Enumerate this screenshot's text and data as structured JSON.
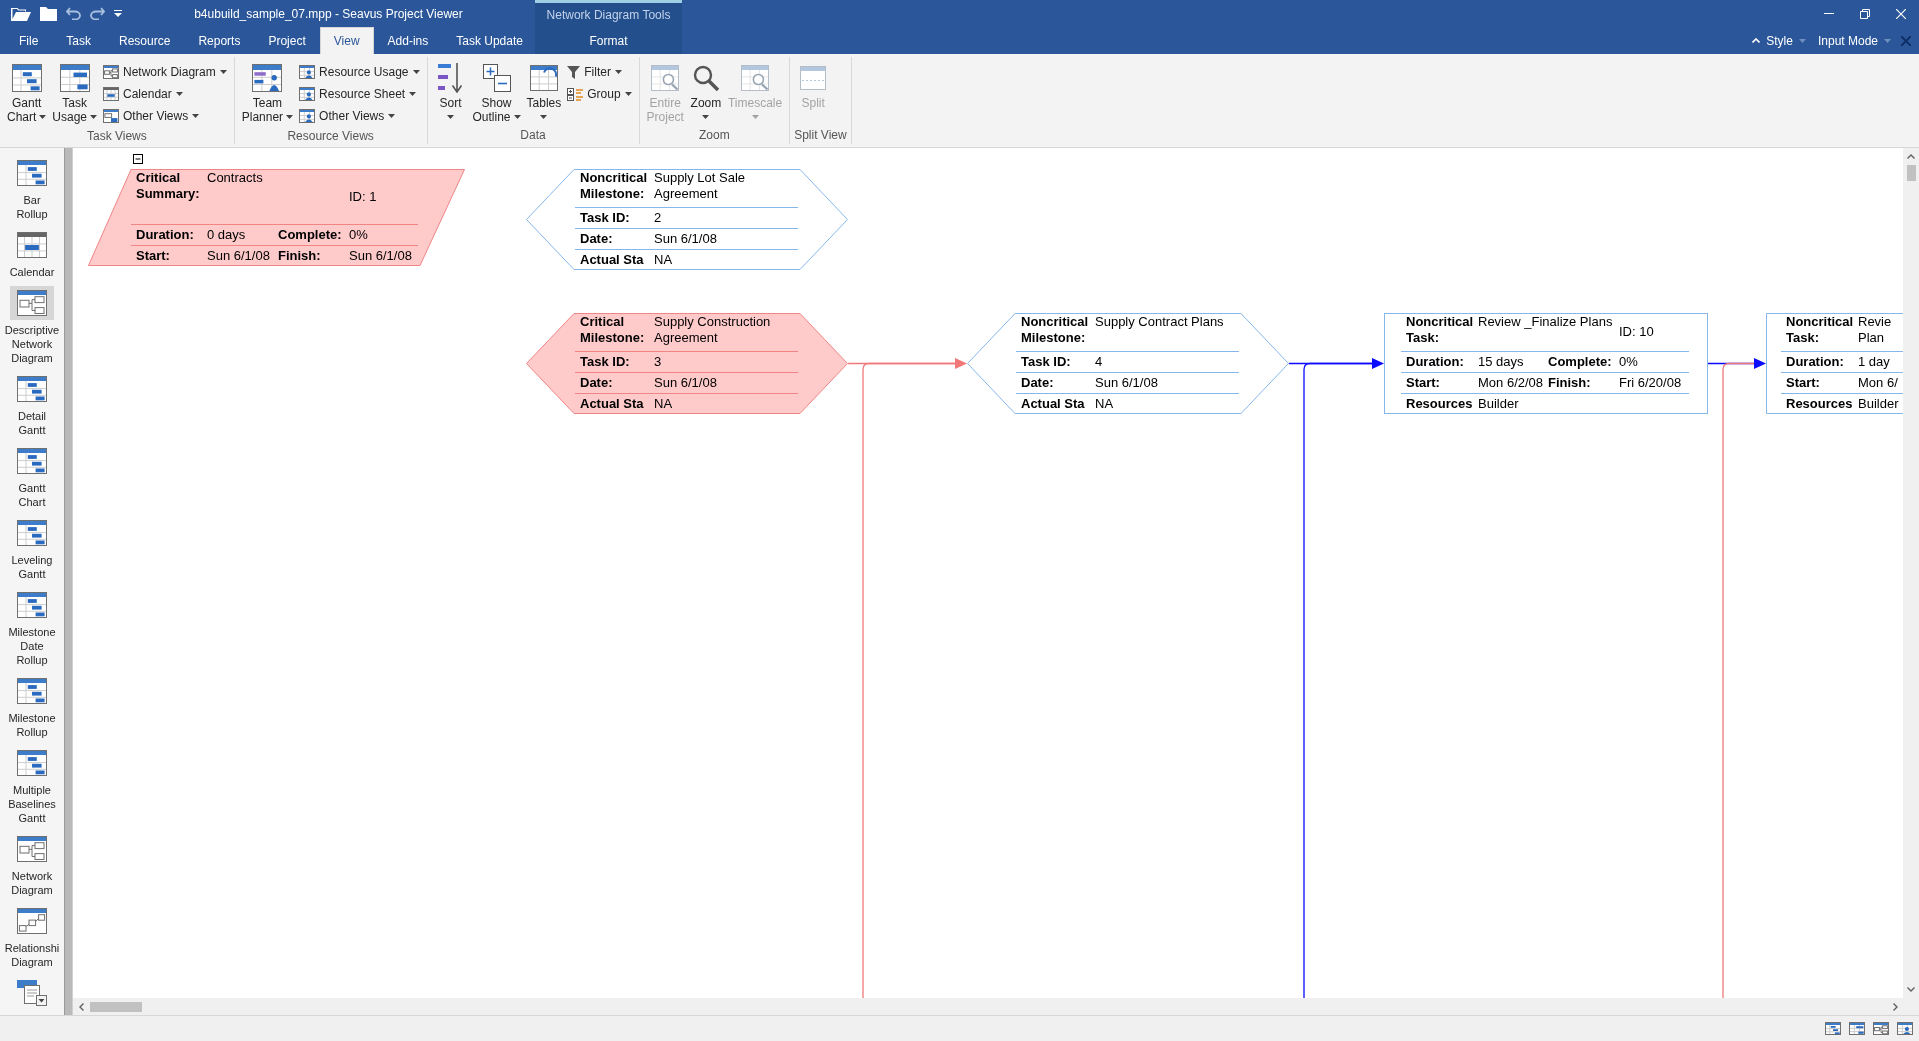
{
  "window": {
    "title": "b4ubuild_sample_07.mpp - Seavus Project Viewer",
    "contextual_group": "Network Diagram Tools"
  },
  "tabs": [
    {
      "label": "File",
      "selected": false
    },
    {
      "label": "Task",
      "selected": false
    },
    {
      "label": "Resource",
      "selected": false
    },
    {
      "label": "Reports",
      "selected": false
    },
    {
      "label": "Project",
      "selected": false
    },
    {
      "label": "View",
      "selected": true
    },
    {
      "label": "Add-ins",
      "selected": false
    },
    {
      "label": "Task Update",
      "selected": false
    }
  ],
  "contextual_tabs": [
    {
      "label": "Format",
      "selected": false
    }
  ],
  "ribbon_options": [
    {
      "label": "Style",
      "dropdown": true
    },
    {
      "label": "Input Mode",
      "dropdown": true
    }
  ],
  "ribbon": {
    "groups": [
      {
        "label": "Task Views",
        "items": [
          {
            "kind": "large",
            "lines": [
              "Gantt",
              "Chart"
            ],
            "dropdown": true,
            "disabled": false
          },
          {
            "kind": "large",
            "lines": [
              "Task",
              "Usage"
            ],
            "dropdown": true,
            "disabled": false
          },
          {
            "kind": "small",
            "label": "Network Diagram",
            "dropdown": true,
            "disabled": false
          },
          {
            "kind": "small",
            "label": "Calendar",
            "dropdown": true,
            "disabled": false
          },
          {
            "kind": "small",
            "label": "Other Views",
            "dropdown": true,
            "disabled": false
          }
        ]
      },
      {
        "label": "Resource Views",
        "items": [
          {
            "kind": "large",
            "lines": [
              "Team",
              "Planner"
            ],
            "dropdown": true,
            "disabled": false
          },
          {
            "kind": "small",
            "label": "Resource Usage",
            "dropdown": true,
            "disabled": false
          },
          {
            "kind": "small",
            "label": "Resource Sheet",
            "dropdown": true,
            "disabled": false
          },
          {
            "kind": "small",
            "label": "Other Views",
            "dropdown": true,
            "disabled": false
          }
        ]
      },
      {
        "label": "Data",
        "items": [
          {
            "kind": "large",
            "lines": [
              "Sort"
            ],
            "dropdown": true,
            "disabled": false
          },
          {
            "kind": "large",
            "lines": [
              "Show",
              "Outline"
            ],
            "dropdown": true,
            "disabled": false
          },
          {
            "kind": "large",
            "lines": [
              "Tables"
            ],
            "dropdown": true,
            "disabled": false
          },
          {
            "kind": "small",
            "label": "Filter",
            "dropdown": true,
            "disabled": false
          },
          {
            "kind": "small",
            "label": "Group",
            "dropdown": true,
            "disabled": false
          }
        ]
      },
      {
        "label": "Zoom",
        "items": [
          {
            "kind": "large",
            "lines": [
              "Entire",
              "Project"
            ],
            "dropdown": false,
            "disabled": true
          },
          {
            "kind": "large",
            "lines": [
              "Zoom"
            ],
            "dropdown": true,
            "disabled": false
          },
          {
            "kind": "large",
            "lines": [
              "Timescale"
            ],
            "dropdown": true,
            "disabled": true
          }
        ]
      },
      {
        "label": "Split View",
        "items": [
          {
            "kind": "large",
            "lines": [
              "Split"
            ],
            "dropdown": false,
            "disabled": true
          }
        ]
      }
    ]
  },
  "sidebar": {
    "items": [
      {
        "label": "Bar Rollup",
        "kind": "gantt",
        "selected": false
      },
      {
        "label": "Calendar",
        "kind": "calendar",
        "selected": false
      },
      {
        "label": "Descriptive Network Diagram",
        "kind": "network",
        "selected": true
      },
      {
        "label": "Detail Gantt",
        "kind": "gantt",
        "selected": false
      },
      {
        "label": "Gantt Chart",
        "kind": "gantt",
        "selected": false
      },
      {
        "label": "Leveling Gantt",
        "kind": "gantt",
        "selected": false
      },
      {
        "label": "Milestone Date Rollup",
        "kind": "gantt",
        "selected": false
      },
      {
        "label": "Milestone Rollup",
        "kind": "gantt",
        "selected": false
      },
      {
        "label": "Multiple Baselines Gantt",
        "kind": "gantt",
        "selected": false
      },
      {
        "label": "Network Diagram",
        "kind": "network",
        "selected": false
      },
      {
        "label": "Relationshi Diagram",
        "kind": "relationship",
        "selected": false
      },
      {
        "kind": "form",
        "selected": false
      }
    ]
  },
  "diagram": {
    "nodes": [
      {
        "kind": "summary",
        "critical": true,
        "expanded": true,
        "type_label": "Critical Summary:",
        "name": "Contracts",
        "id_text": "ID: 1",
        "rows": [
          [
            {
              "label": "Duration:",
              "value": "0 days"
            },
            {
              "label": "Complete:",
              "value": "0%"
            }
          ],
          [
            {
              "label": "Start:",
              "value": "Sun 6/1/08"
            },
            {
              "label": "Finish:",
              "value": "Sun 6/1/08"
            }
          ]
        ]
      },
      {
        "kind": "milestone",
        "critical": false,
        "type_label": "Noncritical Milestone:",
        "name": "Supply Lot Sale Agreement",
        "rows": [
          [
            {
              "label": "Task ID:",
              "value": "2"
            }
          ],
          [
            {
              "label": "Date:",
              "value": "Sun 6/1/08"
            }
          ],
          [
            {
              "label": "Actual Sta",
              "value": "NA"
            }
          ]
        ]
      },
      {
        "kind": "milestone",
        "critical": true,
        "type_label": "Critical Milestone:",
        "name": "Supply Construction Agreement",
        "rows": [
          [
            {
              "label": "Task ID:",
              "value": "3"
            }
          ],
          [
            {
              "label": "Date:",
              "value": "Sun 6/1/08"
            }
          ],
          [
            {
              "label": "Actual Sta",
              "value": "NA"
            }
          ]
        ],
        "arrow": {
          "critical": true
        },
        "branch": {
          "critical": true
        }
      },
      {
        "kind": "milestone",
        "critical": false,
        "type_label": "Noncritical Milestone:",
        "name": "Supply Contract Plans",
        "rows": [
          [
            {
              "label": "Task ID:",
              "value": "4"
            }
          ],
          [
            {
              "label": "Date:",
              "value": "Sun 6/1/08"
            }
          ],
          [
            {
              "label": "Actual Sta",
              "value": "NA"
            }
          ]
        ],
        "arrow": {
          "critical": false
        },
        "branch": {
          "critical": false
        }
      },
      {
        "kind": "task",
        "critical": false,
        "type_label": "Noncritical Task:",
        "name": "Review _Finalize Plans",
        "id_text": "ID: 10",
        "rows": [
          [
            {
              "label": "Duration:",
              "value": "15 days"
            },
            {
              "label": "Complete:",
              "value": "0%"
            }
          ],
          [
            {
              "label": "Start:",
              "value": "Mon 6/2/08"
            },
            {
              "label": "Finish:",
              "value": "Fri 6/20/08"
            }
          ],
          [
            {
              "label": "Resources",
              "value": "Builder"
            }
          ]
        ],
        "arrow": {
          "critical": false
        },
        "branch": {
          "critical": true
        }
      },
      {
        "kind": "task",
        "critical": false,
        "type_label": "Noncritical Task:",
        "name": "Revie Plan",
        "rows": [
          [
            {
              "label": "Duration:",
              "value": "1 day"
            }
          ],
          [
            {
              "label": "Start:",
              "value": "Mon 6/"
            }
          ],
          [
            {
              "label": "Resources",
              "value": "Builder"
            }
          ]
        ]
      }
    ]
  }
}
